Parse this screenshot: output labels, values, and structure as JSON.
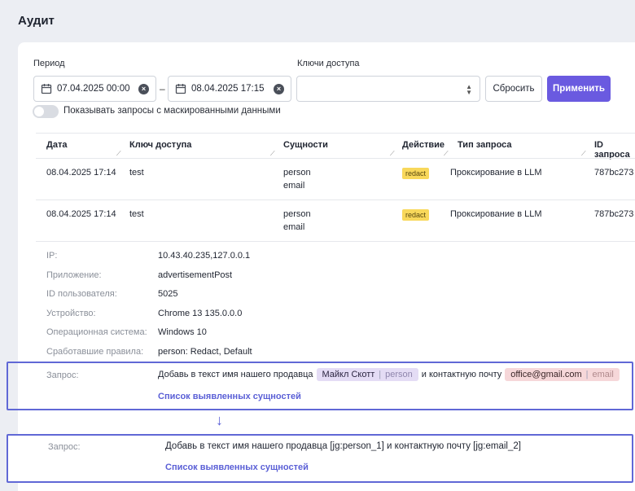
{
  "page": {
    "title": "Аудит"
  },
  "filters": {
    "period_label": "Период",
    "date_from": "07.04.2025 00:00",
    "date_to": "08.04.2025 17:15",
    "dash": "–",
    "keys_label": "Ключи доступа",
    "keys_value": "",
    "reset_label": "Сбросить",
    "apply_label": "Применить",
    "masked_toggle_label": "Показывать запросы с маскированными данными"
  },
  "table": {
    "columns": [
      "Дата",
      "Ключ доступа",
      "Сущности",
      "Действие",
      "Тип запроса",
      "ID запроса"
    ],
    "rows": [
      {
        "date": "08.04.2025 17:14",
        "key": "test",
        "entity1": "person",
        "entity2": "email",
        "action": "redact",
        "type": "Проксирование в LLM",
        "id": "787bc273"
      },
      {
        "date": "08.04.2025 17:14",
        "key": "test",
        "entity1": "person",
        "entity2": "email",
        "action": "redact",
        "type": "Проксирование в LLM",
        "id": "787bc273"
      }
    ]
  },
  "details": {
    "ip_label": "IP:",
    "ip": "10.43.40.235,127.0.0.1",
    "app_label": "Приложение:",
    "app": "advertisementPost",
    "user_label": "ID пользователя:",
    "user": "5025",
    "device_label": "Устройство:",
    "device": "Chrome 13 135.0.0.0",
    "os_label": "Операционная система:",
    "os": "Windows 10",
    "rules_label": "Сработавшие правила:",
    "rules": "person: Redact, Default",
    "request_label": "Запрос:",
    "request_part1": "Добавь в текст имя нашего продавца",
    "chip_person_value": "Майкл Скотт",
    "chip_person_tag": "person",
    "request_part2": "и контактную почту",
    "chip_email_value": "office@gmail.com",
    "chip_email_tag": "email",
    "chip_sep": "|",
    "entities_link": "Список выявленных сущностей"
  },
  "masked": {
    "arrow": "↓",
    "request_label": "Запрос:",
    "request_text": "Добавь в текст имя нашего продавца [jg:person_1] и контактную почту [jg:email_2]",
    "entities_link": "Список выявленных сущностей"
  },
  "colors": {
    "accent": "#6a5ae0",
    "highlight_border": "#6068d6",
    "badge": "#f8d85b"
  }
}
